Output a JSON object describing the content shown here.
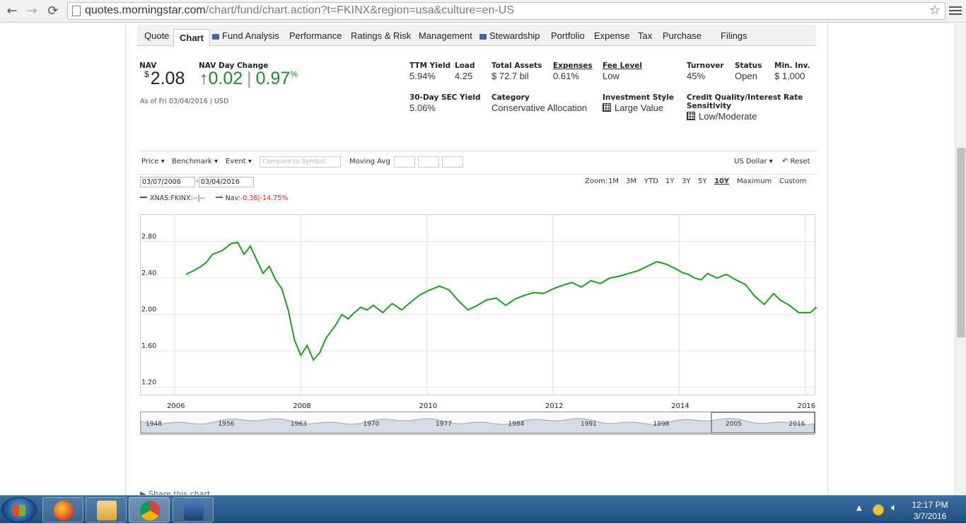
{
  "browser": {
    "url_host": "quotes.morningstar.com",
    "url_path": "/chart/fund/chart.action?t=FKINX&region=usa&culture=en-US"
  },
  "tabs": [
    {
      "label": "Quote",
      "icon": false
    },
    {
      "label": "Chart",
      "icon": false,
      "active": true
    },
    {
      "label": "Fund Analysis",
      "icon": true
    },
    {
      "label": "Performance",
      "icon": false
    },
    {
      "label": "Ratings & Risk",
      "icon": false
    },
    {
      "label": "Management",
      "icon": false
    },
    {
      "label": "Stewardship",
      "icon": true
    },
    {
      "label": "Portfolio",
      "icon": false
    },
    {
      "label": "Expense",
      "icon": false
    },
    {
      "label": "Tax",
      "icon": false
    },
    {
      "label": "Purchase",
      "icon": false
    },
    {
      "label": "Filings",
      "icon": false
    }
  ],
  "quote": {
    "nav_label": "NAV",
    "nav_currency": "$",
    "nav_value": "2.08",
    "day_change_label": "NAV Day Change",
    "day_change_arrow": "↑",
    "day_change_value": "0.02",
    "day_change_sep": "|",
    "day_change_pct": "0.97",
    "pct_sign": "%",
    "as_of": "As of  Fri 03/04/2016 | USD"
  },
  "stats": {
    "ttm_yield_label": "TTM Yield",
    "ttm_yield": "5.94%",
    "load_label": "Load",
    "load": "4.25",
    "total_assets_label": "Total Assets",
    "total_assets": "$ 72.7 bil",
    "expenses_label": "Expenses",
    "expenses": "0.61%",
    "fee_level_label": "Fee Level",
    "fee_level": "Low",
    "turnover_label": "Turnover",
    "turnover": "45%",
    "status_label": "Status",
    "status": "Open",
    "min_inv_label": "Min. Inv.",
    "min_inv": "$ 1,000",
    "sec_yield_label": "30-Day SEC Yield",
    "sec_yield": "5.06%",
    "category_label": "Category",
    "category": "Conservative Allocation",
    "style_label": "Investment Style",
    "style": "Large Value",
    "credit_label": "Credit Quality/Interest Rate Sensitivity",
    "credit": "Low/Moderate"
  },
  "toolbar": {
    "price": "Price ▾",
    "benchmark": "Benchmark ▾",
    "event": "Event ▾",
    "compare_placeholder": "Compare to Symbol",
    "moving_avg": "Moving Avg",
    "currency": "US Dollar ▾",
    "reset": "↶ Reset"
  },
  "dates": {
    "start": "03/07/2006",
    "dash": "-",
    "end": "03/04/2016"
  },
  "zoom": {
    "label": "Zoom:",
    "options": [
      "1M",
      "3M",
      "YTD",
      "1Y",
      "3Y",
      "5Y",
      "10Y",
      "Maximum",
      "Custom"
    ],
    "selected": "10Y"
  },
  "legend": {
    "symbol": "XNAS:FKINX:--|--",
    "nav_label": "Nav:",
    "nav_change": "-0.36|-14.75%"
  },
  "chart_data": {
    "type": "line",
    "series": [
      {
        "name": "Nav",
        "color": "#1e9e1e"
      }
    ],
    "x": [
      2006.18,
      2006.3,
      2006.4,
      2006.5,
      2006.6,
      2006.75,
      2006.9,
      2007.0,
      2007.1,
      2007.2,
      2007.3,
      2007.4,
      2007.5,
      2007.6,
      2007.7,
      2007.8,
      2007.9,
      2008.0,
      2008.1,
      2008.2,
      2008.3,
      2008.4,
      2008.55,
      2008.65,
      2008.75,
      2008.85,
      2008.95,
      2009.05,
      2009.15,
      2009.3,
      2009.45,
      2009.6,
      2009.75,
      2009.9,
      2010.05,
      2010.2,
      2010.35,
      2010.5,
      2010.65,
      2010.8,
      2010.95,
      2011.1,
      2011.25,
      2011.4,
      2011.55,
      2011.7,
      2011.85,
      2012.0,
      2012.15,
      2012.3,
      2012.45,
      2012.6,
      2012.75,
      2012.9,
      2013.05,
      2013.2,
      2013.35,
      2013.5,
      2013.65,
      2013.8,
      2013.95,
      2014.05,
      2014.15,
      2014.25,
      2014.35,
      2014.45,
      2014.6,
      2014.75,
      2014.9,
      2015.05,
      2015.2,
      2015.35,
      2015.5,
      2015.6,
      2015.75,
      2015.9,
      2016.0,
      2016.08,
      2016.18
    ],
    "y": [
      2.44,
      2.48,
      2.52,
      2.57,
      2.66,
      2.7,
      2.78,
      2.79,
      2.66,
      2.75,
      2.6,
      2.45,
      2.53,
      2.38,
      2.28,
      2.05,
      1.72,
      1.55,
      1.66,
      1.5,
      1.58,
      1.74,
      1.88,
      2.0,
      1.95,
      2.02,
      2.08,
      2.05,
      2.1,
      2.02,
      2.12,
      2.05,
      2.14,
      2.22,
      2.27,
      2.31,
      2.27,
      2.15,
      2.05,
      2.1,
      2.16,
      2.18,
      2.1,
      2.17,
      2.21,
      2.24,
      2.23,
      2.28,
      2.32,
      2.35,
      2.3,
      2.37,
      2.34,
      2.4,
      2.42,
      2.45,
      2.48,
      2.53,
      2.58,
      2.55,
      2.5,
      2.46,
      2.44,
      2.4,
      2.38,
      2.45,
      2.4,
      2.44,
      2.38,
      2.33,
      2.2,
      2.11,
      2.23,
      2.16,
      2.1,
      2.02,
      2.02,
      2.02,
      2.08
    ],
    "ylim": [
      1.12,
      3.1
    ],
    "yticks": [
      "2.80",
      "2.40",
      "2.00",
      "1.60",
      "1.20"
    ],
    "ytick_values": [
      2.8,
      2.4,
      2.0,
      1.6,
      1.2
    ],
    "xticks": [
      "2006",
      "2008",
      "2010",
      "2012",
      "2014",
      "2016"
    ],
    "xtick_values": [
      2006,
      2008,
      2010,
      2012,
      2014,
      2016
    ],
    "xlim": [
      2005.45,
      2016.15
    ],
    "grid": true,
    "navigator_ticks": [
      "1948",
      "1956",
      "1963",
      "1970",
      "1977",
      "1984",
      "1991",
      "1998",
      "2005",
      "2016"
    ]
  },
  "footer": {
    "share": "▶ Share this chart"
  },
  "taskbar": {
    "time": "12:17 PM",
    "date": "3/7/2016",
    "apps": [
      "firefox-icon",
      "file-explorer-icon",
      "chrome-icon",
      "media-player-icon"
    ]
  }
}
